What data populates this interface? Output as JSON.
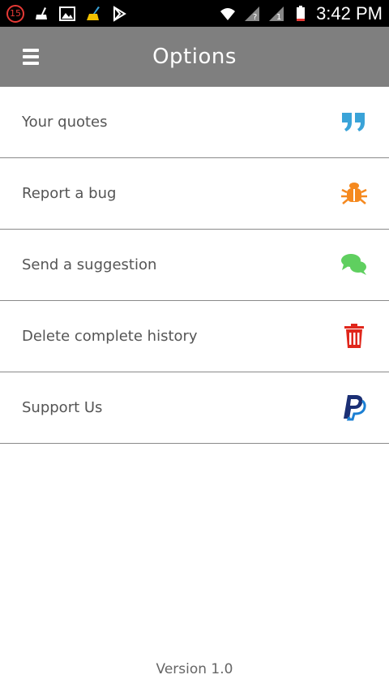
{
  "status_bar": {
    "notification_count": "15",
    "time": "3:42 PM"
  },
  "app_bar": {
    "title": "Options"
  },
  "options": [
    {
      "label": "Your quotes",
      "icon": "quote-icon",
      "color": "#3aa3d8"
    },
    {
      "label": "Report a bug",
      "icon": "bug-icon",
      "color": "#f5891f"
    },
    {
      "label": "Send a suggestion",
      "icon": "chat-bubbles-icon",
      "color": "#5fcf5f"
    },
    {
      "label": "Delete complete history",
      "icon": "trash-icon",
      "color": "#e0261b"
    },
    {
      "label": "Support Us",
      "icon": "paypal-icon",
      "color": "#1b2f74"
    }
  ],
  "footer": {
    "version": "Version 1.0"
  }
}
